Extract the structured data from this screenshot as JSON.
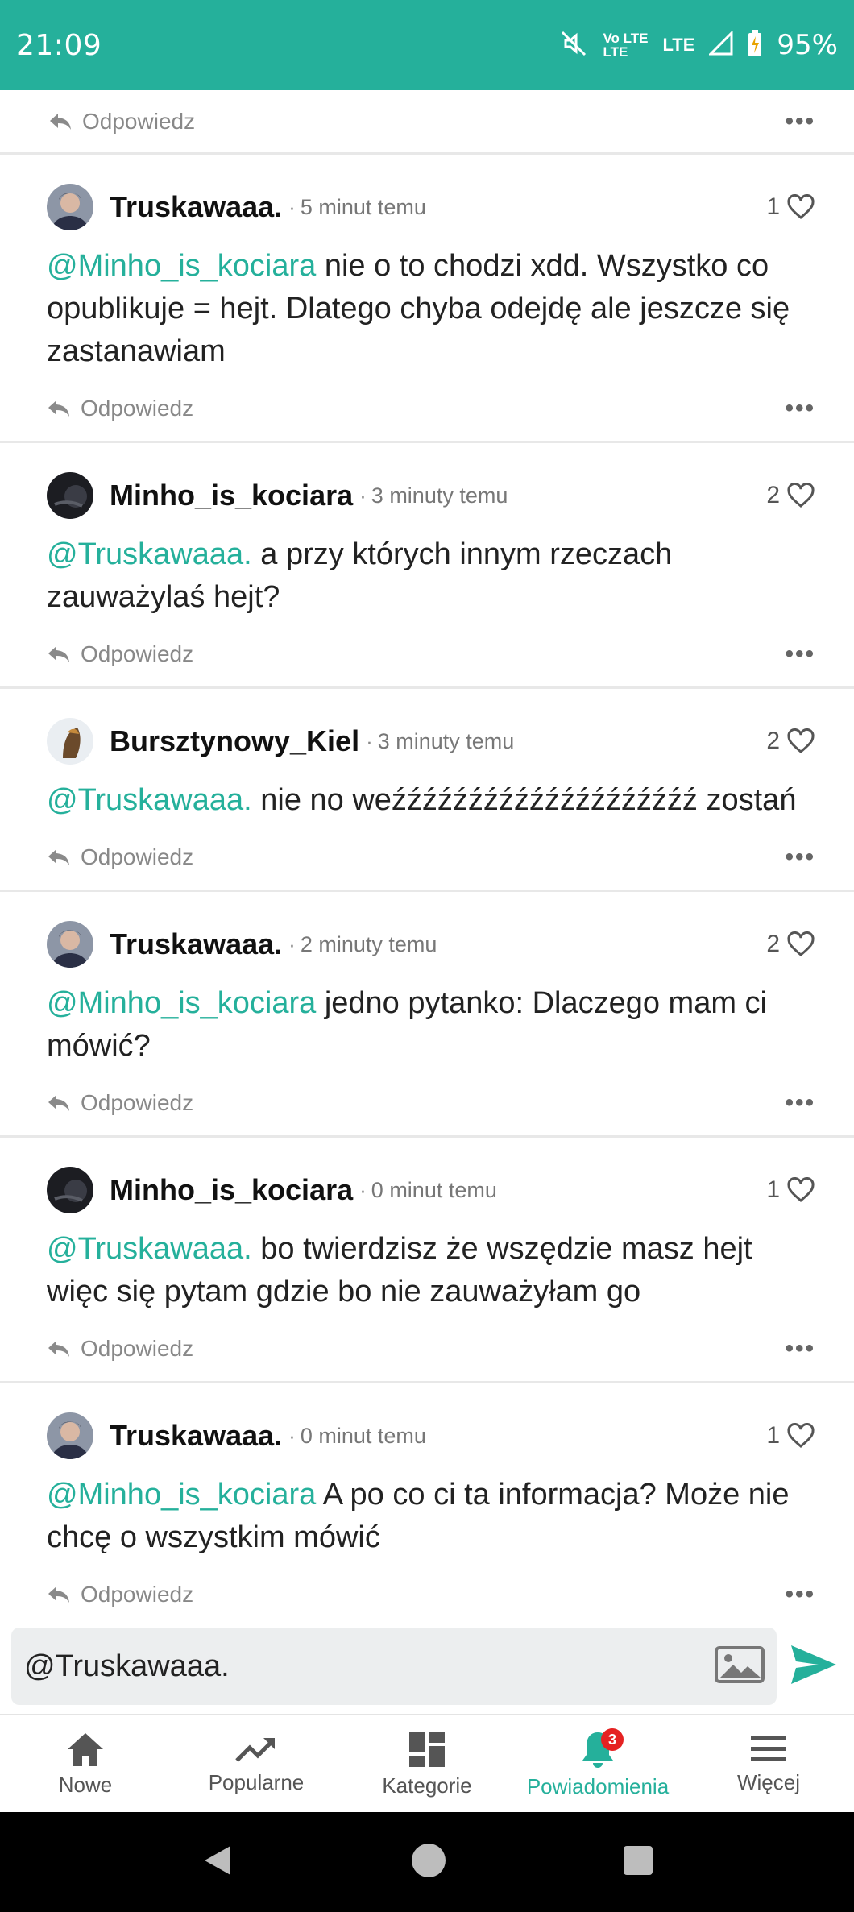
{
  "status_bar": {
    "time": "21:09",
    "lte_top": "Vo LTE",
    "lte_bottom": "LTE",
    "lte_label": "LTE",
    "battery": "95%"
  },
  "partial_comment": {
    "reply_label": "Odpowiedz",
    "more_label": "•••"
  },
  "comments": [
    {
      "author": "Truskawaaa.",
      "time": "5 minut temu",
      "likes": "1",
      "mention": "@Minho_is_kociara",
      "text": " nie o to chodzi xdd. Wszystko co opublikuje = hejt. Dlatego chyba odejdę ale jeszcze się zastanawiam",
      "reply_label": "Odpowiedz",
      "more_label": "•••"
    },
    {
      "author": "Minho_is_kociara",
      "time": "3 minuty temu",
      "likes": "2",
      "mention": "@Truskawaaa.",
      "text": " a przy których innym rzeczach zauważylaś hejt?",
      "reply_label": "Odpowiedz",
      "more_label": "•••"
    },
    {
      "author": "Bursztynowy_Kiel",
      "time": "3 minuty temu",
      "likes": "2",
      "mention": "@Truskawaaa.",
      "text": " nie no weźźźźźźźźźźźźźźźźźźźź zostań",
      "reply_label": "Odpowiedz",
      "more_label": "•••"
    },
    {
      "author": "Truskawaaa.",
      "time": "2 minuty temu",
      "likes": "2",
      "mention": "@Minho_is_kociara",
      "text": " jedno pytanko: Dlaczego mam ci mówić?",
      "reply_label": "Odpowiedz",
      "more_label": "•••"
    },
    {
      "author": "Minho_is_kociara",
      "time": "0 minut temu",
      "likes": "1",
      "mention": "@Truskawaaa.",
      "text": " bo twierdzisz że wszędzie masz hejt więc się pytam gdzie bo nie zauważyłam go",
      "reply_label": "Odpowiedz",
      "more_label": "•••"
    },
    {
      "author": "Truskawaaa.",
      "time": "0 minut temu",
      "likes": "1",
      "mention": "@Minho_is_kociara",
      "text": " A po co ci ta informacja? Może nie chcę o wszystkim mówić",
      "reply_label": "Odpowiedz",
      "more_label": "•••"
    }
  ],
  "composer": {
    "value": "@Truskawaaa."
  },
  "tabs": [
    {
      "label": "Nowe",
      "icon": "home-icon"
    },
    {
      "label": "Popularne",
      "icon": "trending-icon"
    },
    {
      "label": "Kategorie",
      "icon": "grid-icon"
    },
    {
      "label": "Powiadomienia",
      "icon": "bell-icon",
      "badge": "3",
      "active": true
    },
    {
      "label": "Więcej",
      "icon": "menu-icon"
    }
  ],
  "colors": {
    "accent": "#25b09b",
    "badge": "#e52222"
  }
}
